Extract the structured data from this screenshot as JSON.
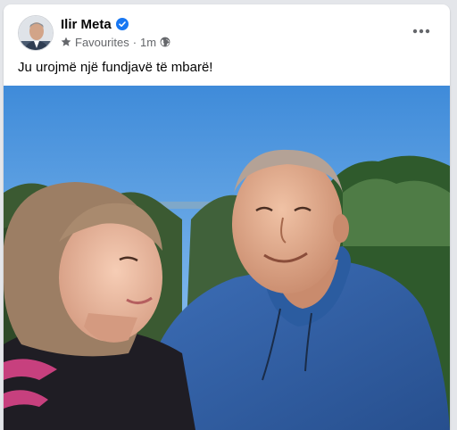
{
  "post": {
    "author": {
      "name": "Ilir Meta",
      "verified": true,
      "avatar_icon": "user-avatar"
    },
    "audience_label": "Favourites",
    "separator": "·",
    "timestamp": "1m",
    "privacy_icon": "globe-icon",
    "more_icon": "more-horizontal-icon",
    "text": "Ju urojmë një fundjavë të mbarë!",
    "photo_icon": "post-photo"
  },
  "colors": {
    "background": "#e4e6ea",
    "card": "#ffffff",
    "primary_text": "#050505",
    "secondary_text": "#65676b",
    "verified_blue": "#1877f2",
    "sky": "#4e97e0"
  }
}
